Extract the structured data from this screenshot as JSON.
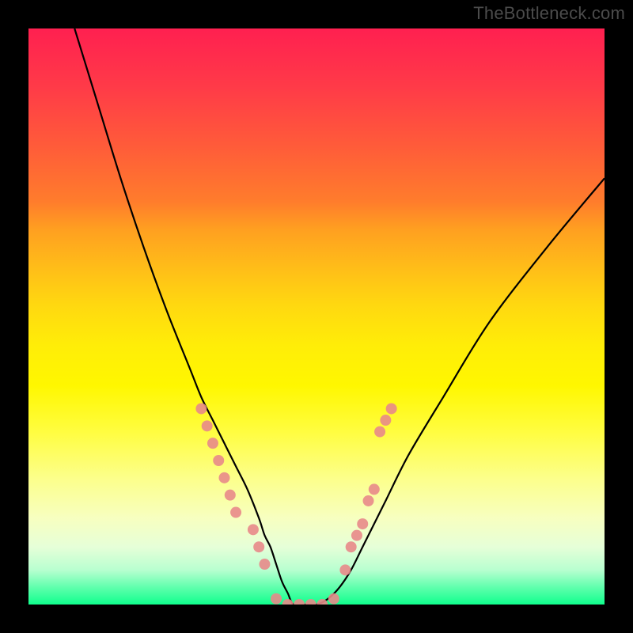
{
  "watermark": "TheBottleneck.com",
  "chart_data": {
    "type": "line",
    "title": "",
    "xlabel": "",
    "ylabel": "",
    "xlim": [
      0,
      100
    ],
    "ylim": [
      0,
      100
    ],
    "grid": false,
    "series": [
      {
        "name": "bottleneck-curve",
        "x": [
          8,
          12,
          16,
          20,
          24,
          28,
          30,
          32,
          34,
          36,
          38,
          40,
          41,
          42,
          43,
          44,
          45,
          46,
          48,
          50,
          52,
          54,
          56,
          58,
          60,
          62,
          66,
          72,
          80,
          90,
          100
        ],
        "y": [
          100,
          87,
          74,
          62,
          51,
          41,
          36,
          32,
          28,
          24,
          20,
          15,
          12,
          10,
          7,
          4,
          2,
          0,
          0,
          0,
          1,
          3,
          6,
          10,
          14,
          18,
          26,
          36,
          49,
          62,
          74
        ]
      }
    ],
    "left_dot_cluster": {
      "x": [
        30,
        31,
        32,
        33,
        34,
        35,
        36,
        39,
        40,
        41
      ],
      "y": [
        34,
        31,
        28,
        25,
        22,
        19,
        16,
        13,
        10,
        7
      ]
    },
    "right_dot_cluster": {
      "x": [
        55,
        56,
        57,
        58,
        59,
        60,
        61,
        62,
        63
      ],
      "y": [
        6,
        10,
        12,
        14,
        18,
        20,
        30,
        32,
        34
      ]
    },
    "bottom_dot_cluster": {
      "x": [
        43,
        45,
        47,
        49,
        51,
        53
      ],
      "y": [
        1,
        0,
        0,
        0,
        0,
        1
      ]
    },
    "dot_color": "#e88a8a",
    "curve_color": "#000000",
    "background_gradient": [
      "#ff2050",
      "#ffed08",
      "#10ff8d"
    ]
  }
}
